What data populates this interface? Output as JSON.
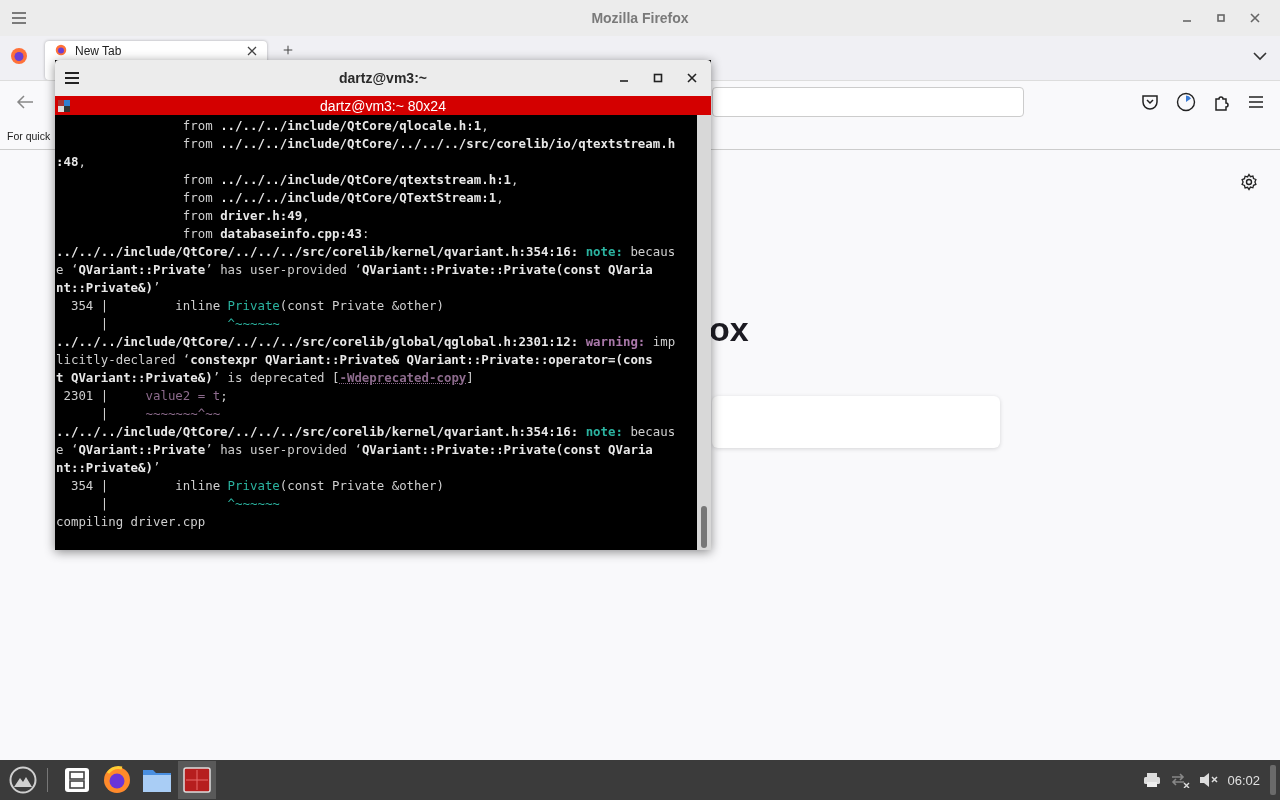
{
  "browser": {
    "window": {
      "title": "Mozilla Firefox"
    },
    "tabs": [
      {
        "label": "New Tab",
        "selected": true
      }
    ],
    "bookmarks_bar": {
      "text": "For quick"
    },
    "content": {
      "logo_text": "ox"
    }
  },
  "terminal": {
    "window": {
      "title": "dartz@vm3:~"
    },
    "tab_title": "dartz@vm3:~ 80x24",
    "lines": [
      {
        "segments": [
          {
            "kind": "plain",
            "text": "                 from "
          },
          {
            "kind": "bold",
            "text": "../../../include/QtCore/qlocale.h:1"
          },
          {
            "kind": "plain",
            "text": ","
          }
        ]
      },
      {
        "segments": [
          {
            "kind": "plain",
            "text": "                 from "
          },
          {
            "kind": "bold",
            "text": "../../../include/QtCore/../../../src/corelib/io/qtextstream.h"
          }
        ]
      },
      {
        "segments": [
          {
            "kind": "bold",
            "text": ":48"
          },
          {
            "kind": "plain",
            "text": ","
          }
        ]
      },
      {
        "segments": [
          {
            "kind": "plain",
            "text": "                 from "
          },
          {
            "kind": "bold",
            "text": "../../../include/QtCore/qtextstream.h:1"
          },
          {
            "kind": "plain",
            "text": ","
          }
        ]
      },
      {
        "segments": [
          {
            "kind": "plain",
            "text": "                 from "
          },
          {
            "kind": "bold",
            "text": "../../../include/QtCore/QTextStream:1"
          },
          {
            "kind": "plain",
            "text": ","
          }
        ]
      },
      {
        "segments": [
          {
            "kind": "plain",
            "text": "                 from "
          },
          {
            "kind": "bold",
            "text": "driver.h:49"
          },
          {
            "kind": "plain",
            "text": ","
          }
        ]
      },
      {
        "segments": [
          {
            "kind": "plain",
            "text": "                 from "
          },
          {
            "kind": "bold",
            "text": "databaseinfo.cpp:43"
          },
          {
            "kind": "plain",
            "text": ":"
          }
        ]
      },
      {
        "segments": [
          {
            "kind": "bold",
            "text": "../../../include/QtCore/../../../src/corelib/kernel/qvariant.h:354:16:"
          },
          {
            "kind": "note",
            "text": " note:"
          },
          {
            "kind": "plain",
            "text": " becaus"
          }
        ]
      },
      {
        "segments": [
          {
            "kind": "plain",
            "text": "e ‘"
          },
          {
            "kind": "bold",
            "text": "QVariant::Private"
          },
          {
            "kind": "plain",
            "text": "’ has user-provided ‘"
          },
          {
            "kind": "bold",
            "text": "QVariant::Private::Private(const QVaria"
          }
        ]
      },
      {
        "segments": [
          {
            "kind": "bold",
            "text": "nt::Private&)"
          },
          {
            "kind": "plain",
            "text": "’"
          }
        ]
      },
      {
        "segments": [
          {
            "kind": "plain",
            "text": "  354 |         inline "
          },
          {
            "kind": "note-plain",
            "text": "Private"
          },
          {
            "kind": "plain",
            "text": "(const Private &other)"
          }
        ]
      },
      {
        "segments": [
          {
            "kind": "plain",
            "text": "      |                "
          },
          {
            "kind": "note-plain",
            "text": "^~~~~~~"
          }
        ]
      },
      {
        "segments": [
          {
            "kind": "bold",
            "text": "../../../include/QtCore/../../../src/corelib/global/qglobal.h:2301:12:"
          },
          {
            "kind": "warning",
            "text": " warning:"
          },
          {
            "kind": "plain",
            "text": " imp"
          }
        ]
      },
      {
        "segments": [
          {
            "kind": "plain",
            "text": "licitly-declared ‘"
          },
          {
            "kind": "bold",
            "text": "constexpr QVariant::Private& QVariant::Private::operator=(cons"
          }
        ]
      },
      {
        "segments": [
          {
            "kind": "bold",
            "text": "t QVariant::Private&)"
          },
          {
            "kind": "plain",
            "text": "’ is deprecated ["
          },
          {
            "kind": "flag",
            "text": "-Wdeprecated-copy"
          },
          {
            "kind": "plain",
            "text": "]"
          }
        ]
      },
      {
        "segments": [
          {
            "kind": "plain",
            "text": " 2301 |     "
          },
          {
            "kind": "warning-plain",
            "text": "value2 = t"
          },
          {
            "kind": "plain",
            "text": ";"
          }
        ]
      },
      {
        "segments": [
          {
            "kind": "plain",
            "text": "      |     "
          },
          {
            "kind": "warning-plain",
            "text": "~~~~~~~^~~"
          }
        ]
      },
      {
        "segments": [
          {
            "kind": "bold",
            "text": "../../../include/QtCore/../../../src/corelib/kernel/qvariant.h:354:16:"
          },
          {
            "kind": "note",
            "text": " note:"
          },
          {
            "kind": "plain",
            "text": " becaus"
          }
        ]
      },
      {
        "segments": [
          {
            "kind": "plain",
            "text": "e ‘"
          },
          {
            "kind": "bold",
            "text": "QVariant::Private"
          },
          {
            "kind": "plain",
            "text": "’ has user-provided ‘"
          },
          {
            "kind": "bold",
            "text": "QVariant::Private::Private(const QVaria"
          }
        ]
      },
      {
        "segments": [
          {
            "kind": "bold",
            "text": "nt::Private&)"
          },
          {
            "kind": "plain",
            "text": "’"
          }
        ]
      },
      {
        "segments": [
          {
            "kind": "plain",
            "text": "  354 |         inline "
          },
          {
            "kind": "note-plain",
            "text": "Private"
          },
          {
            "kind": "plain",
            "text": "(const Private &other)"
          }
        ]
      },
      {
        "segments": [
          {
            "kind": "plain",
            "text": "      |                "
          },
          {
            "kind": "note-plain",
            "text": "^~~~~~~"
          }
        ]
      },
      {
        "segments": [
          {
            "kind": "plain",
            "text": "compiling driver.cpp"
          }
        ]
      }
    ]
  },
  "taskbar": {
    "apps": [
      {
        "kind": "cabinet",
        "selected": false
      },
      {
        "kind": "firefox",
        "selected": false
      },
      {
        "kind": "folder",
        "selected": false
      },
      {
        "kind": "terminal",
        "selected": true
      }
    ],
    "clock": "06:02"
  }
}
